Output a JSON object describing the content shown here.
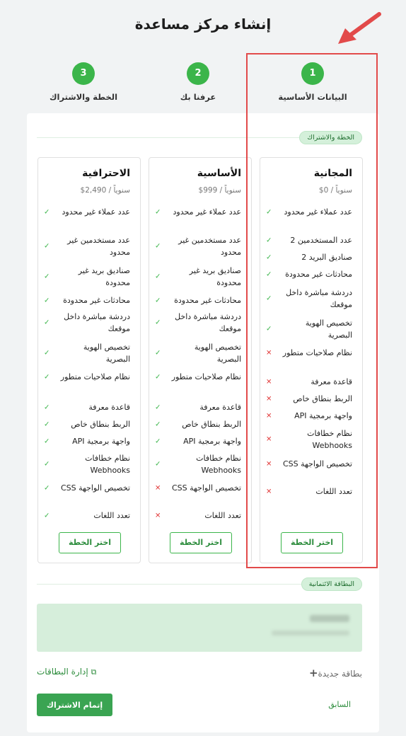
{
  "title": "إنشاء مركز مساعدة",
  "steps": [
    {
      "num": "1",
      "label": "البيانات الأساسية"
    },
    {
      "num": "2",
      "label": "عرفنا بك"
    },
    {
      "num": "3",
      "label": "الخطة والاشتراك"
    }
  ],
  "plan_section": {
    "badge": "الخطة والاشتراك"
  },
  "plans": [
    {
      "name": "المجانية",
      "price": "$0 / سنوياً",
      "features": [
        {
          "text": "عدد عملاء غير محدود",
          "ok": true
        },
        {
          "text": "عدد المستخدمين 2",
          "ok": true
        },
        {
          "text": "صناديق البريد 2",
          "ok": true
        },
        {
          "text": "محادثات غير محدودة",
          "ok": true
        },
        {
          "text": "دردشة مباشرة داخل موقعك",
          "ok": true
        },
        {
          "text": "تخصيص الهوية البصرية",
          "ok": true
        },
        {
          "text": "نظام صلاحيات متطور",
          "ok": false
        },
        {
          "text": "قاعدة معرفة",
          "ok": false
        },
        {
          "text": "الربط بنطاق خاص",
          "ok": false
        },
        {
          "text": "واجهة برمجية API",
          "ok": false
        },
        {
          "text": "نظام خطافات Webhooks",
          "ok": false
        },
        {
          "text": "تخصيص الواجهة CSS",
          "ok": false
        },
        {
          "text": "تعدد اللغات",
          "ok": false
        }
      ],
      "button": "اختر الخطة"
    },
    {
      "name": "الأساسية",
      "price": "$999 / سنوياً",
      "features": [
        {
          "text": "عدد عملاء غير محدود",
          "ok": true
        },
        {
          "text": "عدد مستخدمين غير محدود",
          "ok": true
        },
        {
          "text": "صناديق بريد غير محدودة",
          "ok": true
        },
        {
          "text": "محادثات غير محدودة",
          "ok": true
        },
        {
          "text": "دردشة مباشرة داخل موقعك",
          "ok": true
        },
        {
          "text": "تخصيص الهوية البصرية",
          "ok": true
        },
        {
          "text": "نظام صلاحيات متطور",
          "ok": true
        },
        {
          "text": "قاعدة معرفة",
          "ok": true
        },
        {
          "text": "الربط بنطاق خاص",
          "ok": true
        },
        {
          "text": "واجهة برمجية API",
          "ok": true
        },
        {
          "text": "نظام خطافات Webhooks",
          "ok": true
        },
        {
          "text": "تخصيص الواجهة CSS",
          "ok": false
        },
        {
          "text": "تعدد اللغات",
          "ok": false
        }
      ],
      "button": "اختر الخطة"
    },
    {
      "name": "الاحترافية",
      "price": "$2,490 / سنوياً",
      "features": [
        {
          "text": "عدد عملاء غير محدود",
          "ok": true
        },
        {
          "text": "عدد مستخدمين غير محدود",
          "ok": true
        },
        {
          "text": "صناديق بريد غير محدودة",
          "ok": true
        },
        {
          "text": "محادثات غير محدودة",
          "ok": true
        },
        {
          "text": "دردشة مباشرة داخل موقعك",
          "ok": true
        },
        {
          "text": "تخصيص الهوية البصرية",
          "ok": true
        },
        {
          "text": "نظام صلاحيات متطور",
          "ok": true
        },
        {
          "text": "قاعدة معرفة",
          "ok": true
        },
        {
          "text": "الربط بنطاق خاص",
          "ok": true
        },
        {
          "text": "واجهة برمجية API",
          "ok": true
        },
        {
          "text": "نظام خطافات Webhooks",
          "ok": true
        },
        {
          "text": "تخصيص الواجهة CSS",
          "ok": true
        },
        {
          "text": "تعدد اللغات",
          "ok": true
        }
      ],
      "button": "اختر الخطة"
    }
  ],
  "card_section": {
    "badge": "البطاقة الائتمانية"
  },
  "new_card": "بطاقة جديدة",
  "manage_cards": "إدارة البطاقات",
  "prev": "السابق",
  "submit": "إتمام الاشتراك",
  "colors": {
    "accent": "#3bb54a",
    "highlight": "#e24a4a",
    "cross": "#e23c3c"
  }
}
